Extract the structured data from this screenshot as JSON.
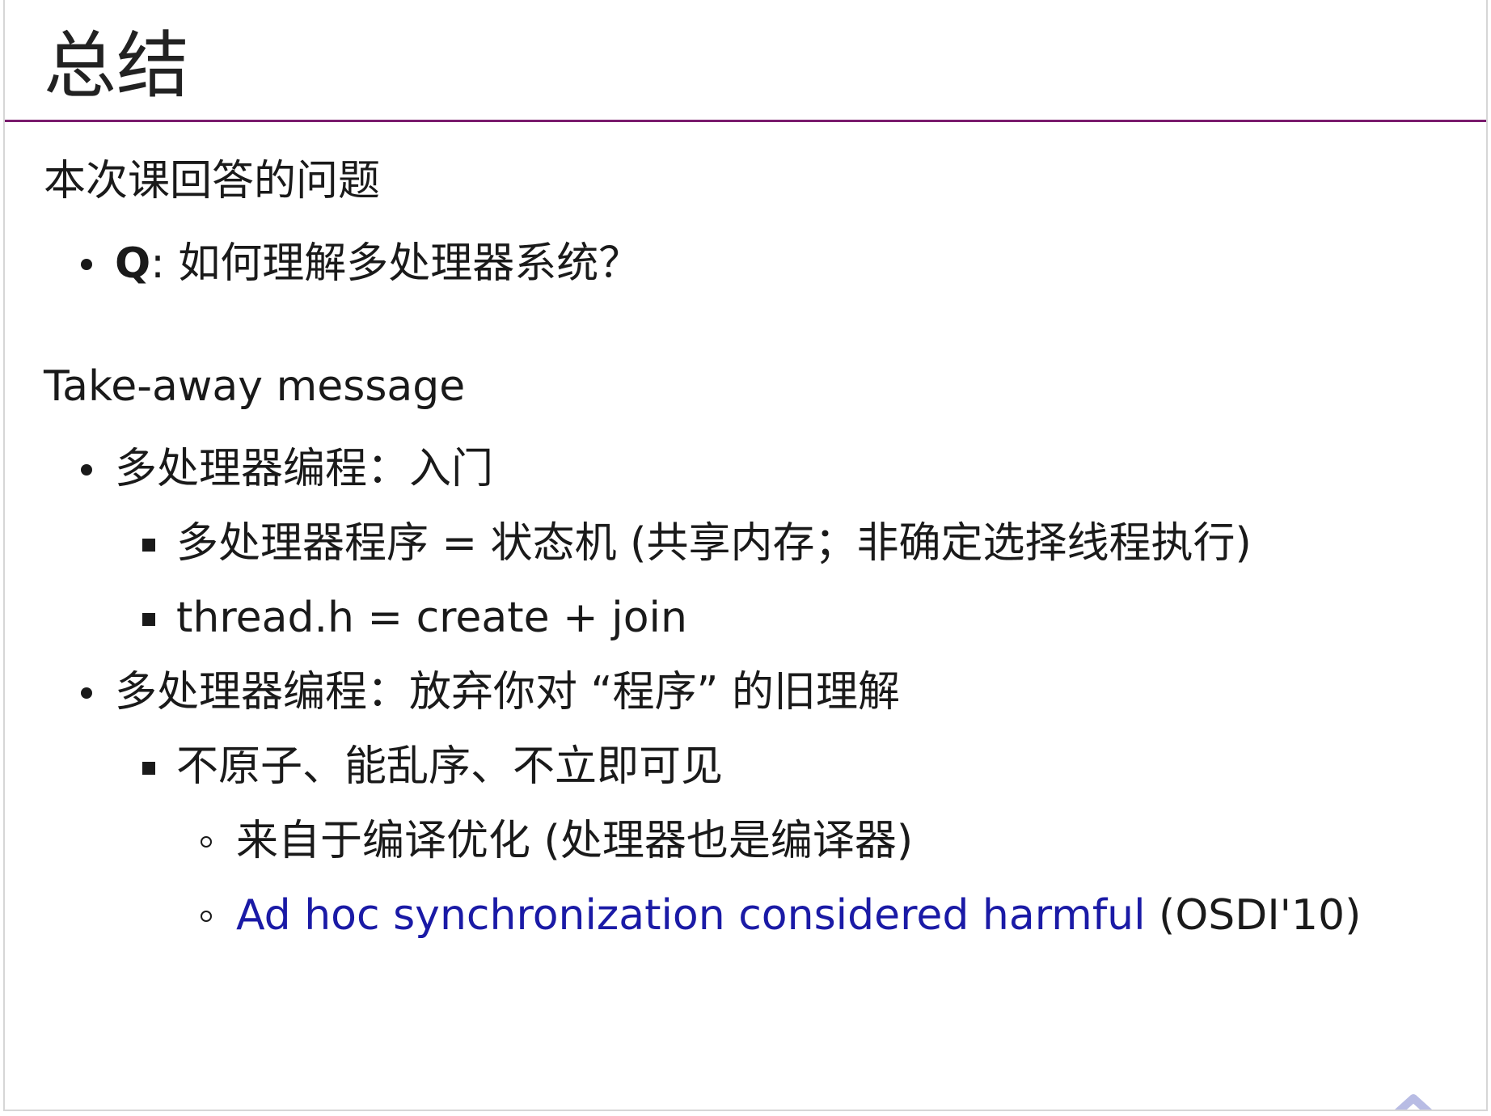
{
  "title": "总结",
  "sections": {
    "questions_heading": "本次课回答的问题",
    "question": {
      "label": "Q",
      "text": ": 如何理解多处理器系统？"
    },
    "takeaway_heading": "Take-away message",
    "points": [
      {
        "text": "多处理器编程：入门",
        "sub": [
          "多处理器程序 = 状态机 (共享内存；非确定选择线程执行)",
          "thread.h = create + join"
        ]
      },
      {
        "text": "多处理器编程：放弃你对 “程序” 的旧理解",
        "sub": [
          "不原子、能乱序、不立即可见"
        ],
        "subsub": [
          "来自于编译优化 (处理器也是编译器)"
        ],
        "link": {
          "text": "Ad hoc synchronization considered harmful",
          "suffix": " (OSDI'10)"
        }
      }
    ]
  },
  "colors": {
    "accent_rule": "#7a1b6d",
    "link": "#1a1aa6",
    "nav_arrow": "#b8bce4"
  },
  "icons": {
    "nav": "chevron-up-icon"
  }
}
